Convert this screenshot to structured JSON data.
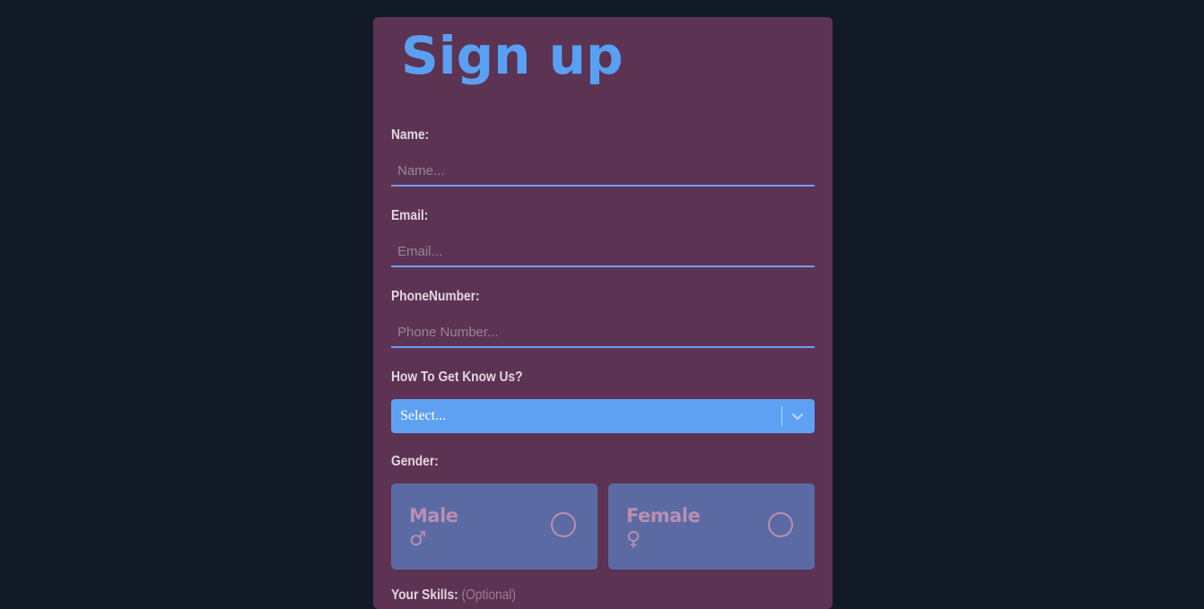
{
  "form": {
    "title": "Sign up",
    "name": {
      "label": "Name:",
      "placeholder": "Name..."
    },
    "email": {
      "label": "Email:",
      "placeholder": "Email..."
    },
    "phone": {
      "label": "PhoneNumber:",
      "placeholder": "Phone Number..."
    },
    "source": {
      "label": "How To Get Know Us?",
      "value": "Select..."
    },
    "gender": {
      "label": "Gender:",
      "options": [
        {
          "label": "Male",
          "symbol": "♂",
          "selected": false
        },
        {
          "label": "Female",
          "symbol": "♀",
          "selected": false
        }
      ]
    },
    "skills": {
      "label": "Your Skills:",
      "optional": "(Optional)"
    }
  },
  "icons": {
    "select": "chevron-down-icon"
  },
  "colors": {
    "background": "#131a27",
    "card": "#5c3352",
    "accent": "#5aa0f2",
    "gender_card": "#5c6aa4"
  }
}
